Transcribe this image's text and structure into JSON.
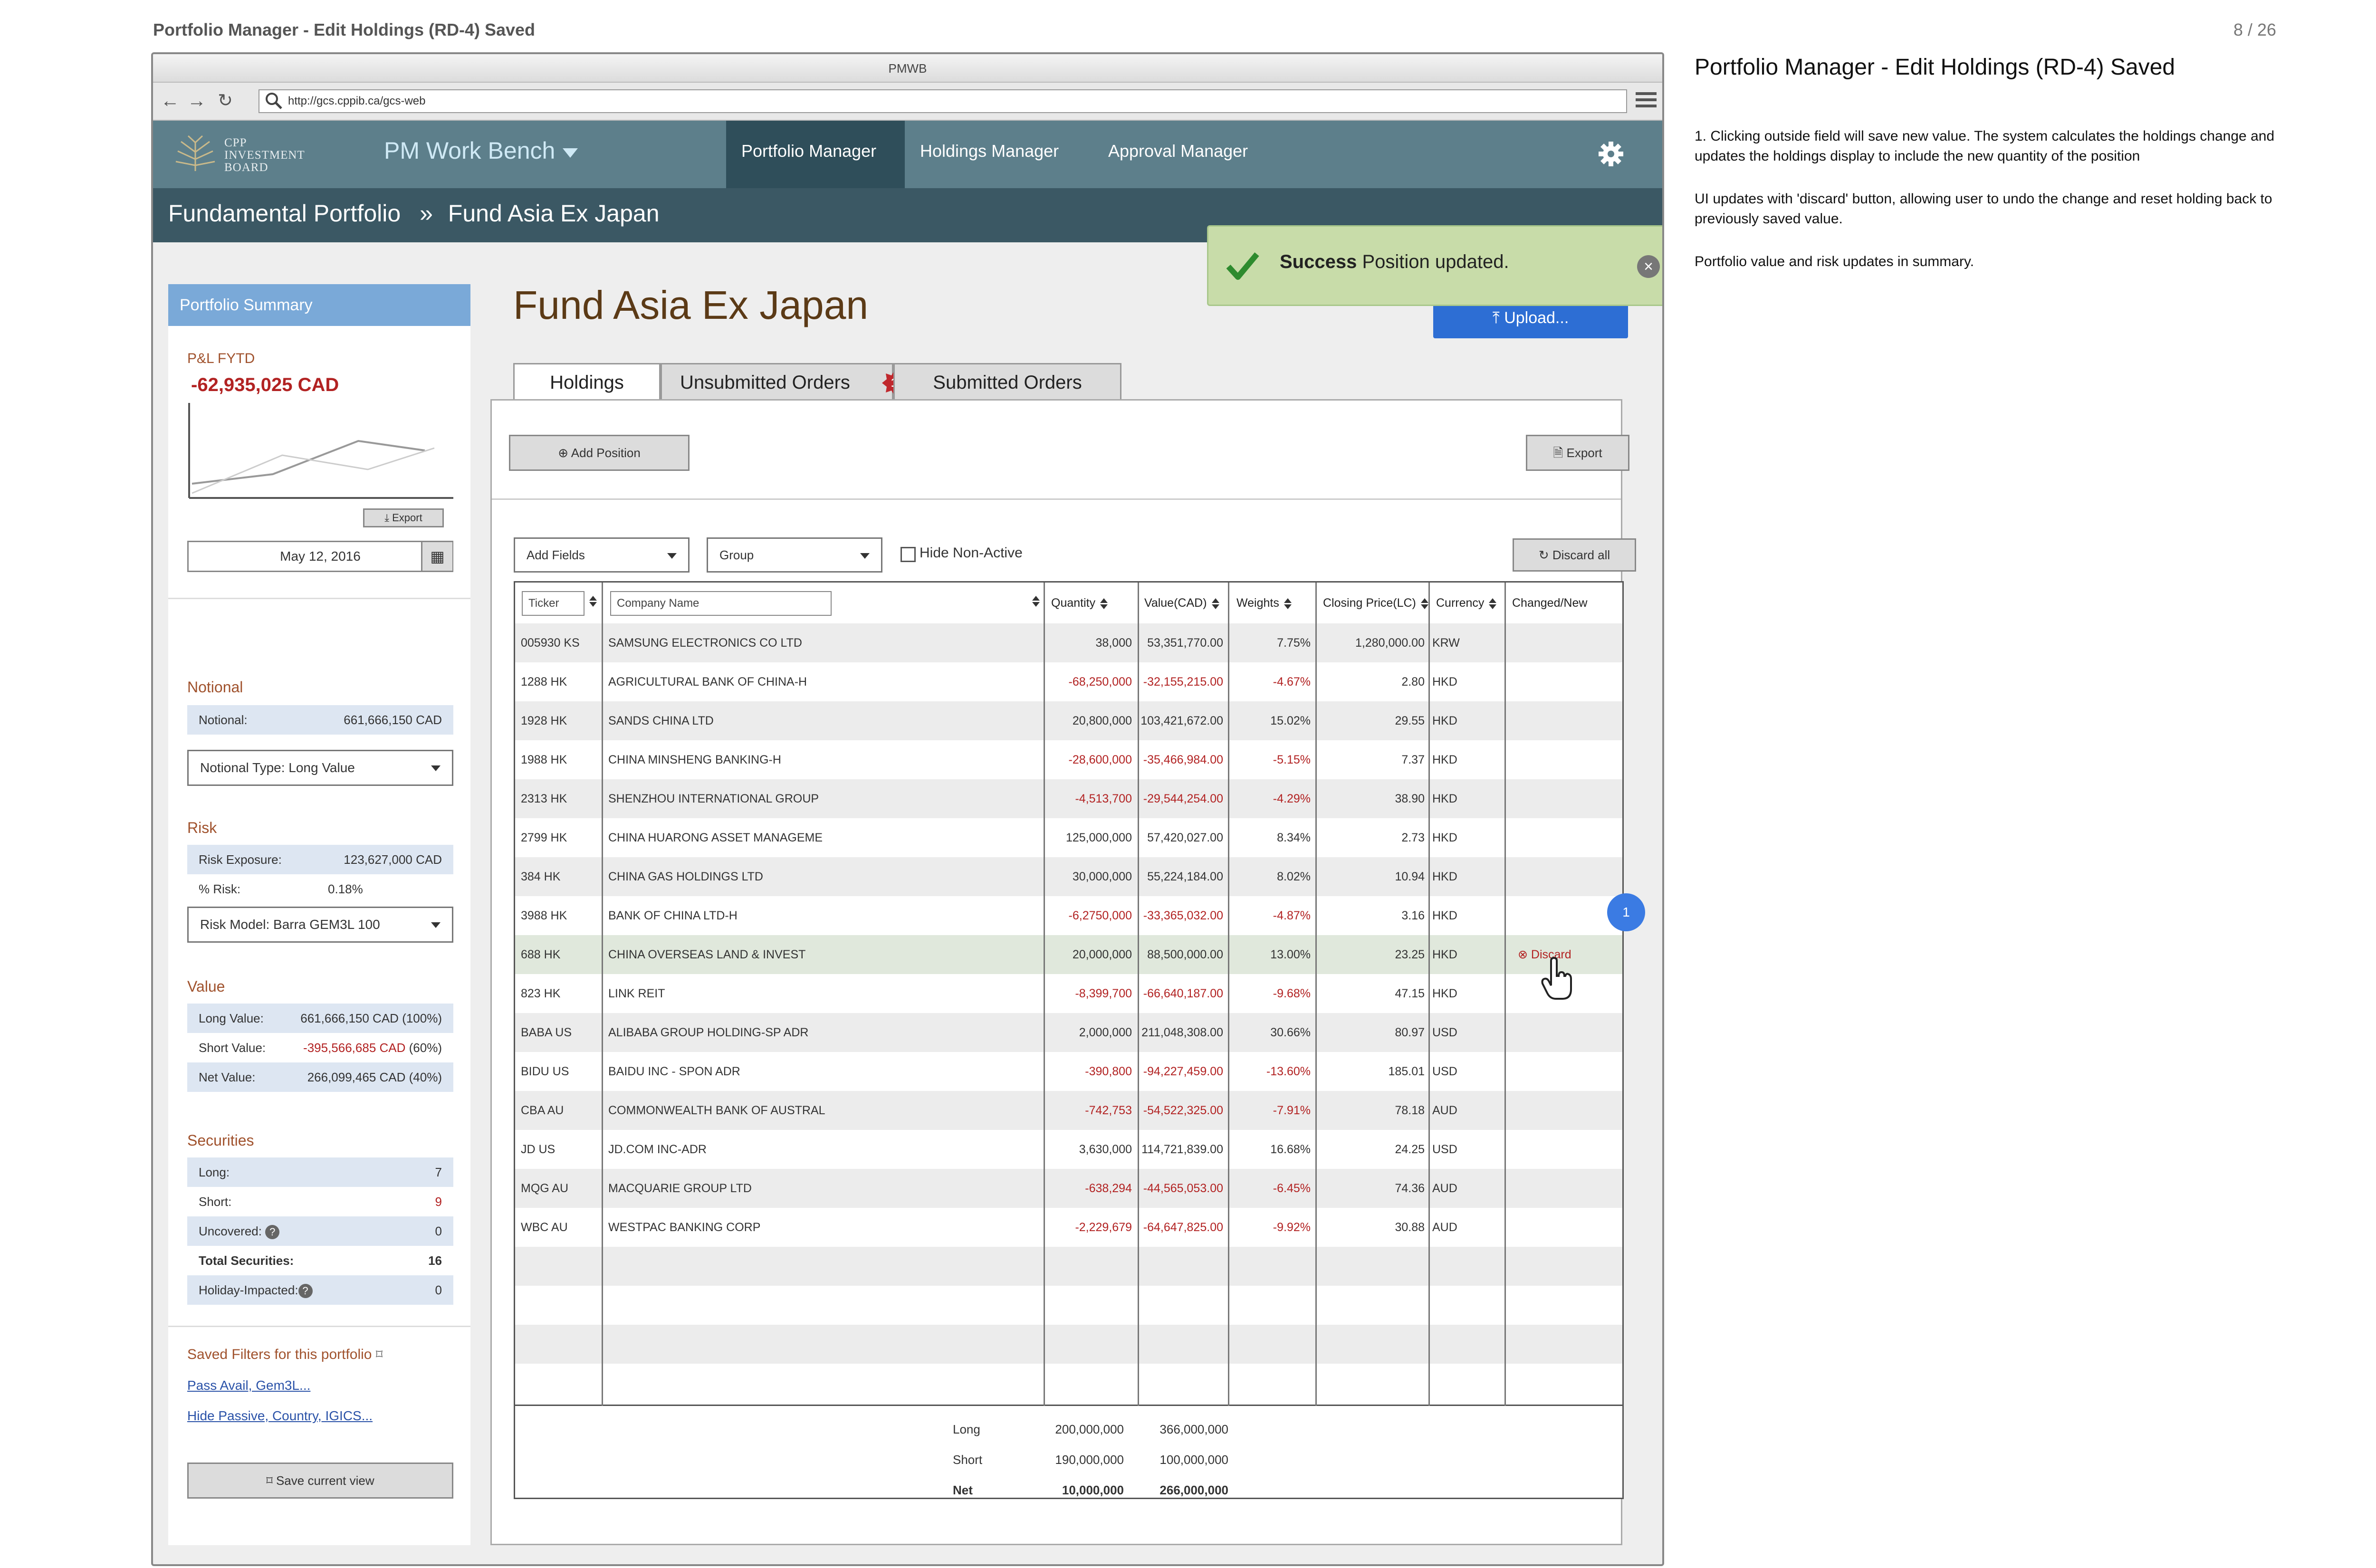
{
  "page": {
    "title": "Portfolio Manager - Edit Holdings (RD-4) Saved",
    "page_number": "8 / 26"
  },
  "browser": {
    "window_title": "PMWB",
    "url": "http://gcs.cppib.ca/gcs-web"
  },
  "app": {
    "logo_lines": [
      "CPP",
      "INVESTMENT",
      "BOARD"
    ],
    "name": "PM Work Bench",
    "nav": [
      "Portfolio Manager",
      "Holdings Manager",
      "Approval Manager"
    ],
    "active_nav": "Portfolio Manager"
  },
  "breadcrumb": {
    "root": "Fundamental Portfolio",
    "separator": "»",
    "current": "Fund Asia Ex Japan"
  },
  "sidebar": {
    "header": "Portfolio Summary",
    "pnl_label": "P&L FYTD",
    "pnl_value": "-62,935,025 CAD",
    "export_label": "Export",
    "date": "May 12, 2016",
    "notional": {
      "label": "Notional",
      "row_label": "Notional:",
      "row_value": "661,666,150 CAD",
      "type_select": "Notional Type: Long Value"
    },
    "risk": {
      "label": "Risk",
      "exposure_label": "Risk Exposure:",
      "exposure_value": "123,627,000 CAD",
      "pct_label": "% Risk:",
      "pct_value": "0.18%",
      "model_select": "Risk Model: Barra GEM3L 100"
    },
    "value": {
      "label": "Value",
      "long_label": "Long Value:",
      "long_value": "661,666,150 CAD (100%)",
      "short_label": "Short Value:",
      "short_value": "-395,566,685 CAD",
      "short_pct": "(60%)",
      "net_label": "Net Value:",
      "net_value": "266,099,465 CAD (40%)"
    },
    "securities": {
      "label": "Securities",
      "long_label": "Long:",
      "long_value": "7",
      "short_label": "Short:",
      "short_value": "9",
      "uncovered_label": "Uncovered:",
      "uncovered_value": "0",
      "total_label": "Total Securities:",
      "total_value": "16",
      "holiday_label": "Holiday-Impacted:",
      "holiday_value": "0"
    },
    "saved_filters": {
      "label": "Saved Filters for this portfolio",
      "links": [
        "Pass Avail, Gem3L...",
        "Hide Passive, Country, IGICS..."
      ],
      "save_button": "Save current view"
    }
  },
  "main": {
    "title": "Fund Asia Ex Japan",
    "upload_button": "Upload...",
    "toast": {
      "strong": "Success",
      "message": "Position updated."
    },
    "tabs": [
      "Holdings",
      "Unsubmitted Orders",
      "Submitted Orders"
    ],
    "unsubmitted_badge": "1",
    "add_position": "Add Position",
    "export": "Export",
    "add_fields": "Add Fields",
    "group": "Group",
    "hide_non_active": "Hide Non-Active",
    "discard_all": "Discard all",
    "table": {
      "headers": {
        "ticker": "Ticker",
        "company": "Company Name",
        "quantity": "Quantity",
        "value": "Value(CAD)",
        "weights": "Weights",
        "closing": "Closing Price(LC)",
        "currency": "Currency",
        "changed": "Changed/New"
      },
      "rows": [
        {
          "ticker": "005930 KS",
          "company": "SAMSUNG ELECTRONICS CO LTD",
          "quantity": "38,000",
          "value": "53,351,770.00",
          "weight": "7.75%",
          "price": "1,280,000.00",
          "currency": "KRW",
          "neg": false
        },
        {
          "ticker": "1288 HK",
          "company": "AGRICULTURAL BANK OF CHINA-H",
          "quantity": "-68,250,000",
          "value": "-32,155,215.00",
          "weight": "-4.67%",
          "price": "2.80",
          "currency": "HKD",
          "neg": true
        },
        {
          "ticker": "1928 HK",
          "company": "SANDS CHINA LTD",
          "quantity": "20,800,000",
          "value": "103,421,672.00",
          "weight": "15.02%",
          "price": "29.55",
          "currency": "HKD",
          "neg": false
        },
        {
          "ticker": "1988 HK",
          "company": "CHINA MINSHENG BANKING-H",
          "quantity": "-28,600,000",
          "value": "-35,466,984.00",
          "weight": "-5.15%",
          "price": "7.37",
          "currency": "HKD",
          "neg": true
        },
        {
          "ticker": "2313 HK",
          "company": "SHENZHOU INTERNATIONAL GROUP",
          "quantity": "-4,513,700",
          "value": "-29,544,254.00",
          "weight": "-4.29%",
          "price": "38.90",
          "currency": "HKD",
          "neg": true
        },
        {
          "ticker": "2799 HK",
          "company": "CHINA HUARONG ASSET MANAGEME",
          "quantity": "125,000,000",
          "value": "57,420,027.00",
          "weight": "8.34%",
          "price": "2.73",
          "currency": "HKD",
          "neg": false
        },
        {
          "ticker": "384 HK",
          "company": "CHINA GAS HOLDINGS LTD",
          "quantity": "30,000,000",
          "value": "55,224,184.00",
          "weight": "8.02%",
          "price": "10.94",
          "currency": "HKD",
          "neg": false
        },
        {
          "ticker": "3988 HK",
          "company": "BANK OF CHINA LTD-H",
          "quantity": "-6,2750,000",
          "value": "-33,365,032.00",
          "weight": "-4.87%",
          "price": "3.16",
          "currency": "HKD",
          "neg": true
        },
        {
          "ticker": "688 HK",
          "company": "CHINA OVERSEAS LAND & INVEST",
          "quantity": "20,000,000",
          "value": "88,500,000.00",
          "weight": "13.00%",
          "price": "23.25",
          "currency": "HKD",
          "neg": false,
          "changed": "Discard"
        },
        {
          "ticker": "823 HK",
          "company": "LINK REIT",
          "quantity": "-8,399,700",
          "value": "-66,640,187.00",
          "weight": "-9.68%",
          "price": "47.15",
          "currency": "HKD",
          "neg": true
        },
        {
          "ticker": "BABA US",
          "company": "ALIBABA GROUP HOLDING-SP ADR",
          "quantity": "2,000,000",
          "value": "211,048,308.00",
          "weight": "30.66%",
          "price": "80.97",
          "currency": "USD",
          "neg": false
        },
        {
          "ticker": "BIDU US",
          "company": "BAIDU INC - SPON ADR",
          "quantity": "-390,800",
          "value": "-94,227,459.00",
          "weight": "-13.60%",
          "price": "185.01",
          "currency": "USD",
          "neg": true
        },
        {
          "ticker": "CBA AU",
          "company": "COMMONWEALTH BANK OF AUSTRAL",
          "quantity": "-742,753",
          "value": "-54,522,325.00",
          "weight": "-7.91%",
          "price": "78.18",
          "currency": "AUD",
          "neg": true
        },
        {
          "ticker": "JD US",
          "company": "JD.COM INC-ADR",
          "quantity": "3,630,000",
          "value": "114,721,839.00",
          "weight": "16.68%",
          "price": "24.25",
          "currency": "USD",
          "neg": false
        },
        {
          "ticker": "MQG AU",
          "company": "MACQUARIE GROUP LTD",
          "quantity": "-638,294",
          "value": "-44,565,053.00",
          "weight": "-6.45%",
          "price": "74.36",
          "currency": "AUD",
          "neg": true
        },
        {
          "ticker": "WBC AU",
          "company": "WESTPAC BANKING CORP",
          "quantity": "-2,229,679",
          "value": "-64,647,825.00",
          "weight": "-9.92%",
          "price": "30.88",
          "currency": "AUD",
          "neg": true
        }
      ],
      "totals": [
        {
          "label": "Long",
          "quantity": "200,000,000",
          "value": "366,000,000"
        },
        {
          "label": "Short",
          "quantity": "190,000,000",
          "value": "100,000,000"
        },
        {
          "label": "Net",
          "quantity": "10,000,000",
          "value": "266,000,000"
        }
      ]
    },
    "step_marker": "1"
  },
  "annotations": {
    "title": "Portfolio Manager - Edit Holdings (RD-4) Saved",
    "notes": [
      "1. Clicking outside field will save new value.   The system calculates the holdings change and updates the holdings display to include the new quantity of the position",
      "UI updates with 'discard' button, allowing user to undo the change and reset holding back to previously saved value.",
      " Portfolio value and risk updates in summary."
    ]
  },
  "colors": {
    "nav_bg": "#5d7f8b",
    "breadcrumb_bg": "#3b5864",
    "sidebar_header": "#7aa9d8",
    "upload_button": "#2d6ed4",
    "toast_bg": "#c8dca9",
    "negative": "#b22222",
    "section_label": "#a0522d"
  }
}
